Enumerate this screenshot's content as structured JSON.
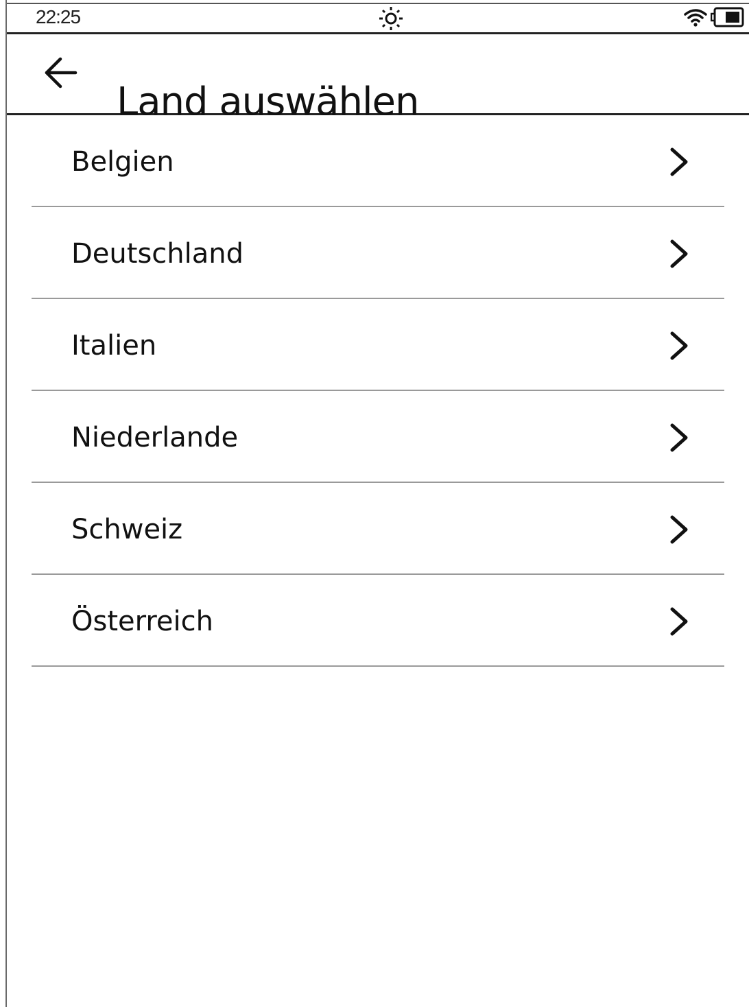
{
  "status_bar": {
    "time": "22:25",
    "icons": [
      "brightness-icon",
      "wifi-icon",
      "battery-icon"
    ]
  },
  "header": {
    "back_icon": "back-arrow-icon",
    "title": "Land auswählen"
  },
  "countries": [
    {
      "label": "Belgien",
      "icon": "chevron-right-icon"
    },
    {
      "label": "Deutschland",
      "icon": "chevron-right-icon"
    },
    {
      "label": "Italien",
      "icon": "chevron-right-icon"
    },
    {
      "label": "Niederlande",
      "icon": "chevron-right-icon"
    },
    {
      "label": "Schweiz",
      "icon": "chevron-right-icon"
    },
    {
      "label": "Österreich",
      "icon": "chevron-right-icon"
    }
  ]
}
